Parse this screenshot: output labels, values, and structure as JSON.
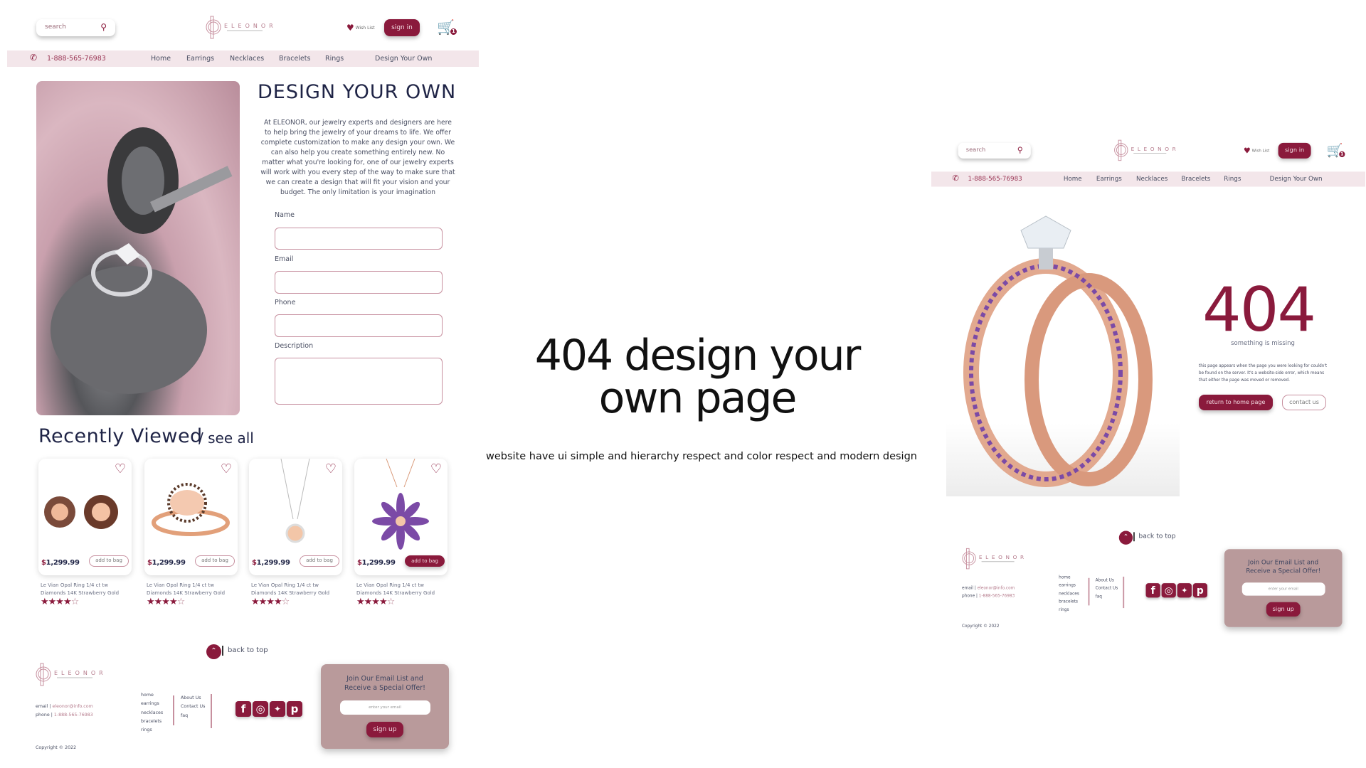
{
  "header": {
    "search_placeholder": "search",
    "wish_list": "Wish List",
    "sign_in": "sign in",
    "cart_count": "1",
    "logo": "ELEONOR",
    "phone": "1-888-565-76983",
    "nav": [
      "Home",
      "Earrings",
      "Necklaces",
      "Bracelets",
      "Rings",
      "Design Your Own"
    ]
  },
  "design_page": {
    "title": "DESIGN YOUR OWN",
    "intro": "At ELEONOR, our jewelry experts and designers are here to help bring the jewelry of your dreams to life. We offer complete customization to make any design your own. We can also help you create something entirely new. No matter what you're looking for, one of our jewelry experts will work with you every step of the way to make sure that we can create a design that will fit your vision and your budget. The only limitation is your imagination",
    "form": {
      "name_label": "Name",
      "email_label": "Email",
      "phone_label": "Phone",
      "description_label": "Description"
    },
    "recently_viewed": "Recently Viewed",
    "see_all": "/ see all",
    "products": [
      {
        "price_symbol": "$",
        "price": "1,299.99",
        "add": "add to bag",
        "name1": "Le Vian Opal Ring 1/4 ct tw",
        "name2": "Diamonds 14K Strawberry Gold",
        "rating": 4,
        "highlighted": false
      },
      {
        "price_symbol": "$",
        "price": "1,299.99",
        "add": "add to bag",
        "name1": "Le Vian Opal Ring 1/4 ct tw",
        "name2": "Diamonds 14K Strawberry Gold",
        "rating": 4,
        "highlighted": false
      },
      {
        "price_symbol": "$",
        "price": "1,299.99",
        "add": "add to bag",
        "name1": "Le Vian Opal Ring 1/4 ct tw",
        "name2": "Diamonds 14K Strawberry Gold",
        "rating": 4,
        "highlighted": false
      },
      {
        "price_symbol": "$",
        "price": "1,299.99",
        "add": "add to bag",
        "name1": "Le Vian Opal Ring 1/4 ct tw",
        "name2": "Diamonds 14K Strawberry Gold",
        "rating": 4,
        "highlighted": true
      }
    ]
  },
  "center": {
    "headline1": "404 design your",
    "headline2": "own page",
    "caption": "website have ui simple and hierarchy respect and color respect and modern design"
  },
  "error_page": {
    "code": "404",
    "subtitle": "something is missing",
    "text": "this page appears when the page you were looking for couldn't be found on the server. It's a website-side error, which means that either the page was moved or removed.",
    "return_btn": "return to home page",
    "contact_btn": "contact us"
  },
  "footer": {
    "back_to_top": "back to top",
    "email_label": "email",
    "email": "eleonor@info.com",
    "phone_label": "phone",
    "phone": "1-888-565-76983",
    "copyright": "Copyright © 2022",
    "links": [
      "home",
      "earrings",
      "necklaces",
      "bracelets",
      "rings"
    ],
    "links2": [
      "About Us",
      "Contact Us",
      "faq"
    ],
    "social": [
      "facebook",
      "instagram",
      "twitter",
      "pinterest"
    ],
    "newsletter_title1": "Join Our Email List and",
    "newsletter_title2": "Receive a Special Offer!",
    "email_placeholder": "enter your email",
    "sign_up": "sign up"
  },
  "colors": {
    "brand": "#8a1a3c",
    "nav_bg": "#f3e6ea",
    "newsletter_bg": "#b99a9b",
    "text": "#4a4f63"
  }
}
